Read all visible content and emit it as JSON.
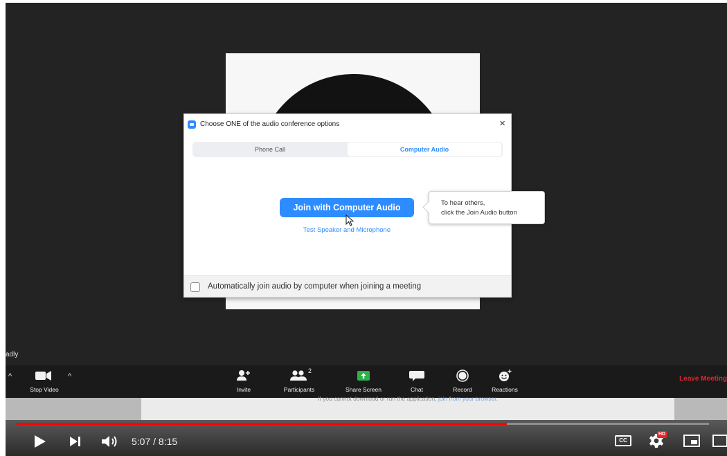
{
  "dialog": {
    "title": "Choose ONE of the audio conference options",
    "close_glyph": "×",
    "tabs": [
      {
        "label": "Phone Call",
        "selected": false
      },
      {
        "label": "Computer Audio",
        "selected": true
      }
    ],
    "join_button_label": "Join with Computer Audio",
    "test_link_label": "Test Speaker and Microphone",
    "auto_join_label": "Automatically join audio by computer when joining a meeting",
    "auto_join_checked": false
  },
  "tooltip": {
    "line1": "To hear others,",
    "line2": "click the Join Audio button"
  },
  "overlay_fragment": "adly",
  "toolbar": {
    "stop_video_label": "Stop Video",
    "invite_label": "Invite",
    "participants_label": "Participants",
    "participants_count": "2",
    "share_screen_label": "Share Screen",
    "chat_label": "Chat",
    "record_label": "Record",
    "reactions_label": "Reactions",
    "leave_label": "Leave Meeting",
    "caret_glyph": "^",
    "share_color": "#2fb04a",
    "leave_color": "#e0262d"
  },
  "browser_page": {
    "text": "If you cannot download or run the application, ",
    "link": "join from your browser."
  },
  "player": {
    "time_display": "5:07 / 8:15",
    "progress_fraction": 0.708,
    "cc_label": "CC",
    "hd_badge": "HD",
    "accent_color": "#ff0000"
  },
  "colors": {
    "zoom_blue": "#2d8cff"
  }
}
